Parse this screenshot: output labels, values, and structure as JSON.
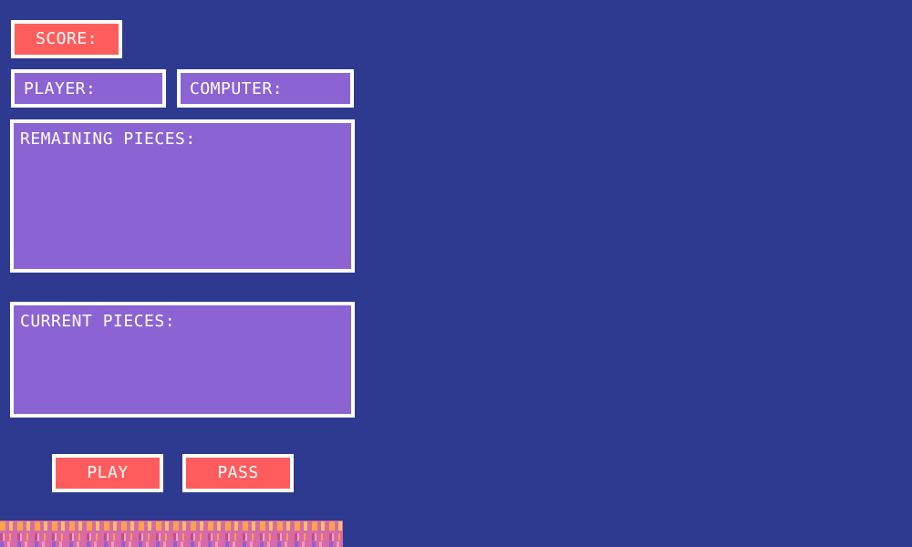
{
  "score": {
    "label": "SCORE:"
  },
  "player": {
    "label": "PLAYER:"
  },
  "computer": {
    "label": "COMPUTER:"
  },
  "remaining_pieces": {
    "label": "REMAINING PIECES:"
  },
  "current_pieces": {
    "label": "CURRENT PIECES:"
  },
  "buttons": {
    "play": "PLAY",
    "pass": "PASS"
  },
  "colors": {
    "background": "#2e3a8f",
    "panel_fill": "#8b63d3",
    "button_fill": "#ff5d5d",
    "border": "#ffffff"
  }
}
